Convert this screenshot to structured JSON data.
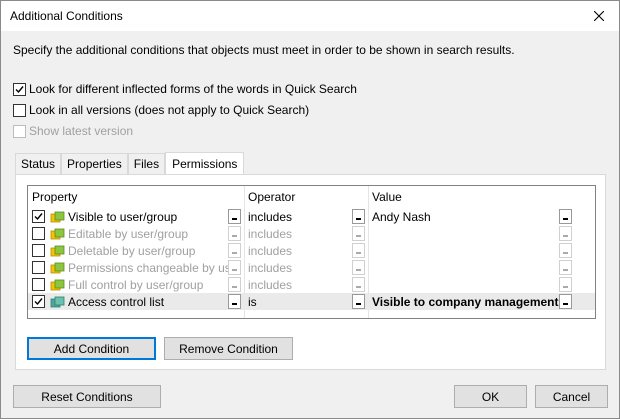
{
  "window": {
    "title": "Additional Conditions"
  },
  "description": "Specify the additional conditions that objects must meet in order to be shown in search results.",
  "options": [
    {
      "label": "Look for different inflected forms of the words in Quick Search",
      "checked": true,
      "enabled": true
    },
    {
      "label": "Look in all versions (does not apply to Quick Search)",
      "checked": false,
      "enabled": true
    },
    {
      "label": "Show latest version",
      "checked": false,
      "enabled": false
    }
  ],
  "tabs": [
    "Status",
    "Properties",
    "Files",
    "Permissions"
  ],
  "active_tab": "Permissions",
  "grid": {
    "headers": {
      "property": "Property",
      "operator": "Operator",
      "value": "Value"
    },
    "rows": [
      {
        "checked": true,
        "enabled": true,
        "icon": "users-icon",
        "property": "Visible to user/group",
        "operator": "includes",
        "value": "Andy Nash",
        "bold": false
      },
      {
        "checked": false,
        "enabled": false,
        "icon": "users-icon",
        "property": "Editable by user/group",
        "operator": "includes",
        "value": "",
        "bold": false
      },
      {
        "checked": false,
        "enabled": false,
        "icon": "users-icon",
        "property": "Deletable by user/group",
        "operator": "includes",
        "value": "",
        "bold": false
      },
      {
        "checked": false,
        "enabled": false,
        "icon": "users-icon",
        "property": "Permissions changeable by user/group",
        "operator": "includes",
        "value": "",
        "bold": false
      },
      {
        "checked": false,
        "enabled": false,
        "icon": "users-icon",
        "property": "Full control by user/group",
        "operator": "includes",
        "value": "",
        "bold": false
      },
      {
        "checked": true,
        "enabled": true,
        "icon": "acl-icon",
        "property": "Access control list",
        "operator": "is",
        "value": "Visible to company management",
        "bold": true
      }
    ]
  },
  "buttons": {
    "add_condition": "Add Condition",
    "remove_condition": "Remove Condition",
    "reset_conditions": "Reset Conditions",
    "ok": "OK",
    "cancel": "Cancel"
  },
  "colors": {
    "accent": "#0078d7",
    "icon_green": "#8cc63f",
    "icon_yellow": "#f5c400",
    "icon_teal": "#3a9a8a"
  }
}
